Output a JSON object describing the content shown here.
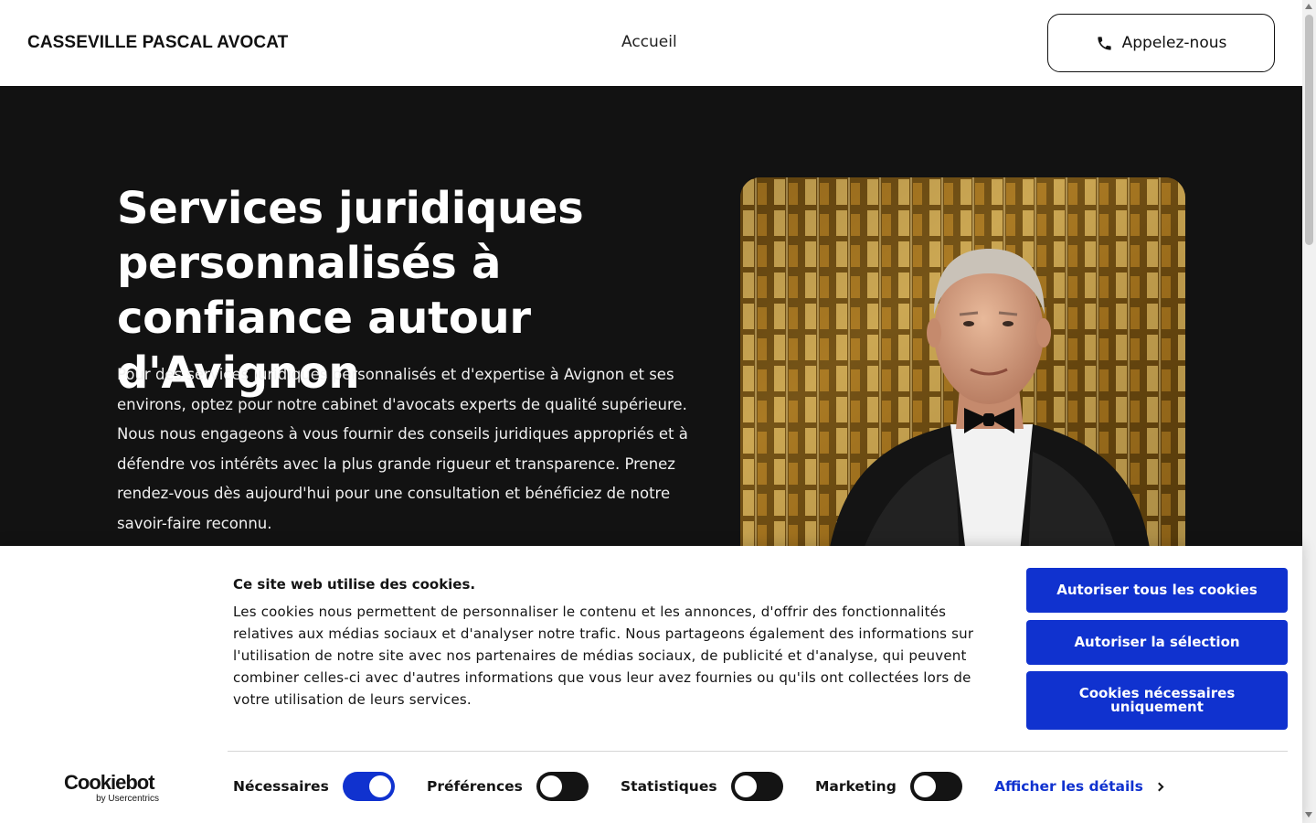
{
  "header": {
    "brand": "CASSEVILLE PASCAL AVOCAT",
    "nav": [
      {
        "label": "Accueil"
      }
    ],
    "call_label": "Appelez-nous",
    "call_icon": "phone-icon"
  },
  "hero": {
    "title": "Services juridiques personnalisés à confiance autour d'Avignon",
    "text": "Pour des services juridiques personnalisés et d'expertise à Avignon et ses environs, optez pour notre cabinet d'avocats experts de qualité supérieure. Nous nous engageons à vous fournir des conseils juridiques appropriés et à défendre vos intérêts avec la plus grande rigueur et transparence. Prenez rendez-vous dès aujourd'hui pour une consultation et bénéficiez de notre savoir-faire reconnu.",
    "background_color": "#121212"
  },
  "cookie": {
    "title": "Ce site web utilise des cookies.",
    "body": "Les cookies nous permettent de personnaliser le contenu et les annonces, d'offrir des fonctionnalités relatives aux médias sociaux et d'analyser notre trafic. Nous partageons également des informations sur l'utilisation de notre site avec nos partenaires de médias sociaux, de publicité et d'analyse, qui peuvent combiner celles-ci avec d'autres informations que vous leur avez fournies ou qu'ils ont collectées lors de votre utilisation de leurs services.",
    "buttons": {
      "allow_all": "Autoriser tous les cookies",
      "allow_selection": "Autoriser la sélection",
      "necessary_only": "Cookies nécessaires uniquement"
    },
    "toggles": [
      {
        "label": "Nécessaires",
        "on": true
      },
      {
        "label": "Préférences",
        "on": false
      },
      {
        "label": "Statistiques",
        "on": false
      },
      {
        "label": "Marketing",
        "on": false
      }
    ],
    "details_label": "Afficher les détails",
    "logo": {
      "main": "Cookiebot",
      "sub": "by Usercentrics"
    },
    "accent_color": "#1032cf"
  }
}
